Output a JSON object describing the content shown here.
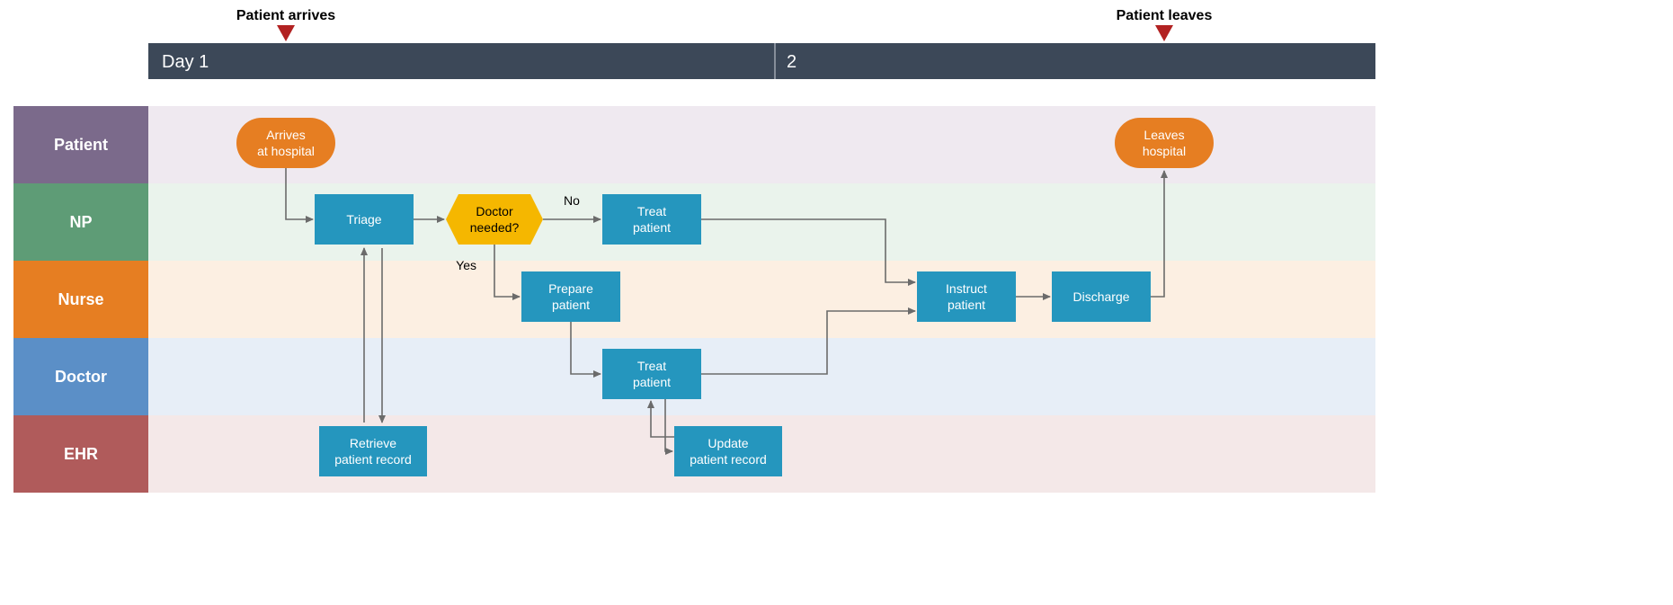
{
  "timeline": {
    "labels": {
      "day1": "Day 1",
      "day2": "2"
    },
    "markers": {
      "arrives": "Patient arrives",
      "leaves": "Patient leaves"
    }
  },
  "lanes": {
    "patient": "Patient",
    "np": "NP",
    "nurse": "Nurse",
    "doctor": "Doctor",
    "ehr": "EHR"
  },
  "nodes": {
    "arrives": {
      "line1": "Arrives",
      "line2": "at hospital"
    },
    "triage": {
      "line1": "Triage"
    },
    "decision": {
      "line1": "Doctor",
      "line2": "needed?"
    },
    "treat_np": {
      "line1": "Treat",
      "line2": "patient"
    },
    "prepare": {
      "line1": "Prepare",
      "line2": "patient"
    },
    "treat_doc": {
      "line1": "Treat",
      "line2": "patient"
    },
    "retrieve": {
      "line1": "Retrieve",
      "line2": "patient record"
    },
    "update": {
      "line1": "Update",
      "line2": "patient record"
    },
    "instruct": {
      "line1": "Instruct",
      "line2": "patient"
    },
    "discharge": {
      "line1": "Discharge"
    },
    "leaves": {
      "line1": "Leaves",
      "line2": "hospital"
    }
  },
  "edgeLabels": {
    "no": "No",
    "yes": "Yes"
  },
  "colors": {
    "timeline": "#3c4858",
    "process": "#2596be",
    "terminator": "#E67E22",
    "decision": "#F5B700",
    "marker": "#B22222",
    "lanes": {
      "patient": {
        "box": "#7B6A8B",
        "bg": "#EFE9F0"
      },
      "np": {
        "box": "#5E9C76",
        "bg": "#EAF3EC"
      },
      "nurse": {
        "box": "#E67E22",
        "bg": "#FCEFE2"
      },
      "doctor": {
        "box": "#5B8FC7",
        "bg": "#E7EEF7"
      },
      "ehr": {
        "box": "#B05B5B",
        "bg": "#F4E8E8"
      }
    }
  }
}
